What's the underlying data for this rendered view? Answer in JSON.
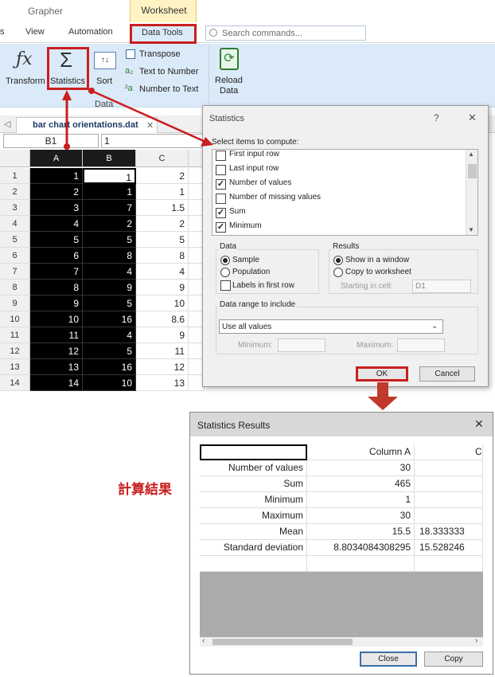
{
  "app": {
    "title": "Grapher",
    "context_tab_group": "Worksheet"
  },
  "menu": {
    "items": [
      "View",
      "Automation",
      "Data Tools"
    ],
    "search_placeholder": "Search commands..."
  },
  "ribbon": {
    "transform": "Transform",
    "statistics": "Statistics",
    "sort": "Sort",
    "transpose": "Transpose",
    "text_to_number": "Text to Number",
    "number_to_text": "Number to Text",
    "reload": "Reload",
    "reload2": "Data",
    "group_label": "Data"
  },
  "doc_tab": {
    "label": "bar chart orientations.dat"
  },
  "formula_bar": {
    "cell": "B1",
    "value": "1"
  },
  "worksheet": {
    "columns": [
      "A",
      "B",
      "C"
    ],
    "rows": [
      [
        "1",
        "1",
        "1",
        "2"
      ],
      [
        "2",
        "2",
        "1",
        "1"
      ],
      [
        "3",
        "3",
        "7",
        "1.5"
      ],
      [
        "4",
        "4",
        "2",
        "2"
      ],
      [
        "5",
        "5",
        "5",
        "5"
      ],
      [
        "6",
        "6",
        "8",
        "8"
      ],
      [
        "7",
        "7",
        "4",
        "4"
      ],
      [
        "8",
        "8",
        "9",
        "9"
      ],
      [
        "9",
        "9",
        "5",
        "10"
      ],
      [
        "10",
        "10",
        "16",
        "8.6"
      ],
      [
        "11",
        "11",
        "4",
        "9"
      ],
      [
        "12",
        "12",
        "5",
        "11"
      ],
      [
        "13",
        "13",
        "16",
        "12"
      ],
      [
        "14",
        "14",
        "10",
        "13"
      ]
    ]
  },
  "dialog": {
    "title": "Statistics",
    "help": "?",
    "close": "✕",
    "select_label": "Select items to compute:",
    "items": [
      {
        "label": "First input row",
        "checked": false
      },
      {
        "label": "Last input row",
        "checked": false
      },
      {
        "label": "Number of values",
        "checked": true
      },
      {
        "label": "Number of missing values",
        "checked": false
      },
      {
        "label": "Sum",
        "checked": true
      },
      {
        "label": "Minimum",
        "checked": true
      }
    ],
    "data_group": {
      "label": "Data",
      "sample": "Sample",
      "population": "Population",
      "labels_first_row": "Labels in first row"
    },
    "results_group": {
      "label": "Results",
      "show_window": "Show in a window",
      "copy_ws": "Copy to worksheet",
      "starting_cell_label": "Starting in cell:",
      "starting_cell": "D1"
    },
    "range_group": {
      "label": "Data range to include",
      "select": "Use all values",
      "min_label": "Minimum:",
      "max_label": "Maximum:"
    },
    "ok": "OK",
    "cancel": "Cancel"
  },
  "annotation": {
    "text": "計算結果"
  },
  "results": {
    "title": "Statistics Results",
    "close": "✕",
    "headers": [
      "",
      "Column A",
      "C"
    ],
    "rows": [
      [
        "Number of values",
        "30",
        ""
      ],
      [
        "Sum",
        "465",
        ""
      ],
      [
        "Minimum",
        "1",
        ""
      ],
      [
        "Maximum",
        "30",
        ""
      ],
      [
        "Mean",
        "15.5",
        "18.333333"
      ],
      [
        "Standard deviation",
        "8.8034084308295",
        "15.528246"
      ]
    ],
    "close_btn": "Close",
    "copy_btn": "Copy"
  },
  "colors": {
    "accent_red": "#c91f1f",
    "ribbon_blue": "#dbeaf8"
  }
}
